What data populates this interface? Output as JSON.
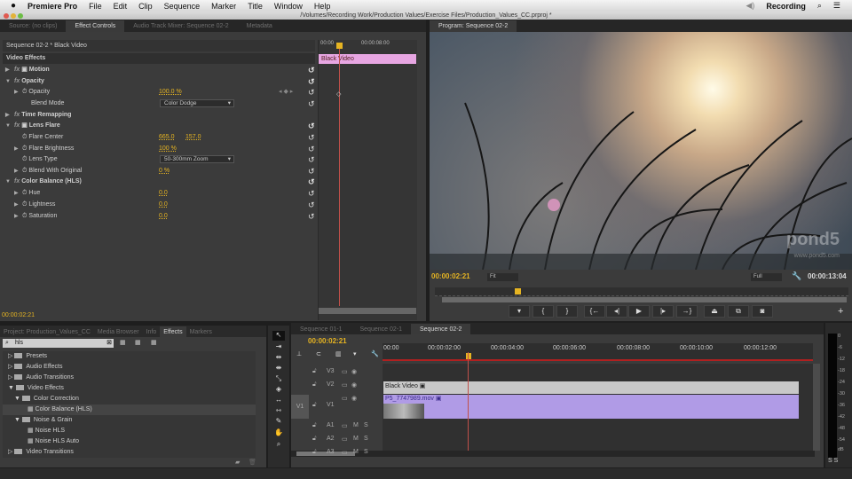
{
  "menubar": {
    "app": "Premiere Pro",
    "items": [
      "File",
      "Edit",
      "Clip",
      "Sequence",
      "Marker",
      "Title",
      "Window",
      "Help"
    ],
    "user": "Recording"
  },
  "window": {
    "title": "/Volumes/Recording Work/Production Values/Exercise Files/Production_Values_CC.prproj *"
  },
  "top_tabs": {
    "source": "Source: (no clips)",
    "effect_controls": "Effect Controls",
    "audio_mixer": "Audio Track Mixer: Sequence 02-2",
    "metadata": "Metadata"
  },
  "effect_controls": {
    "clip_header": "Sequence 02-2 * Black Video",
    "section": "Video Effects",
    "mini_timeline": {
      "start": "00:00",
      "end": "00:00:08:00",
      "clip": "Black Video"
    },
    "rows": [
      {
        "label": "Motion"
      },
      {
        "label": "Opacity"
      },
      {
        "label": "Opacity",
        "value": "100.0 %"
      },
      {
        "label": "Blend Mode",
        "value": "Color Dodge"
      },
      {
        "label": "Time Remapping"
      },
      {
        "label": "Lens Flare"
      },
      {
        "label": "Flare Center",
        "value": "665.0",
        "value2": "157.0"
      },
      {
        "label": "Flare Brightness",
        "value": "100 %"
      },
      {
        "label": "Lens Type",
        "value": "50-300mm Zoom"
      },
      {
        "label": "Blend With Original",
        "value": "0 %"
      },
      {
        "label": "Color Balance (HLS)"
      },
      {
        "label": "Hue",
        "value": "0.0"
      },
      {
        "label": "Lightness",
        "value": "0.0"
      },
      {
        "label": "Saturation",
        "value": "0.0"
      }
    ],
    "timecode": "00:00:02:21"
  },
  "program": {
    "tab": "Program: Sequence 02-2",
    "timecode": "00:00:02:21",
    "fit": "Fit",
    "quality": "Full",
    "duration": "00:00:13:04",
    "watermark": "pond5",
    "watermark_url": "www.pond5.com"
  },
  "bottom_tabs": {
    "project": "Project: Production_Values_CC",
    "media_browser": "Media Browser",
    "info": "Info",
    "effects": "Effects",
    "markers": "Markers"
  },
  "effects_panel": {
    "search": "hls",
    "tree": [
      "Presets",
      "Audio Effects",
      "Audio Transitions",
      "Video Effects",
      "Color Correction",
      "Color Balance (HLS)",
      "Noise & Grain",
      "Noise HLS",
      "Noise HLS Auto",
      "Video Transitions"
    ]
  },
  "timeline": {
    "tabs": [
      "Sequence 01-1",
      "Sequence 02-1",
      "Sequence 02-2"
    ],
    "timecode": "00:00:02:21",
    "ruler": [
      "00:00",
      "00:00:02:00",
      "00:00:04:00",
      "00:00:06:00",
      "00:00:08:00",
      "00:00:10:00",
      "00:00:12:00"
    ],
    "tracks": {
      "v3": "V3",
      "v2": "V2",
      "v1": "V1",
      "src_v1": "V1",
      "a1": "A1",
      "a2": "A2",
      "a3": "A3",
      "m": "M",
      "s": "S"
    },
    "clips": {
      "black_video": "Black Video",
      "movie": "P5_7747989.mov"
    }
  },
  "audio_meter": {
    "labels": [
      "0",
      "-6",
      "-12",
      "-18",
      "-24",
      "-30",
      "-36",
      "-42",
      "-48",
      "-54",
      "dB"
    ],
    "solo": "S S"
  }
}
